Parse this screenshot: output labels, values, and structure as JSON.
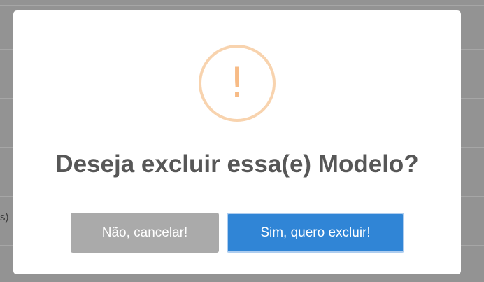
{
  "background": {
    "partial_text": "s)"
  },
  "dialog": {
    "icon": "exclamation-warning-icon",
    "icon_glyph": "!",
    "title": "Deseja excluir essa(e) Modelo?",
    "cancel_label": "Não, cancelar!",
    "confirm_label": "Sim, quero excluir!"
  },
  "colors": {
    "overlay": "#939393",
    "icon_ring": "#f8d3ae",
    "icon_glyph": "#f7bb86",
    "title_text": "#575757",
    "cancel_button": "#aaaaaa",
    "confirm_button": "#3085d6"
  }
}
